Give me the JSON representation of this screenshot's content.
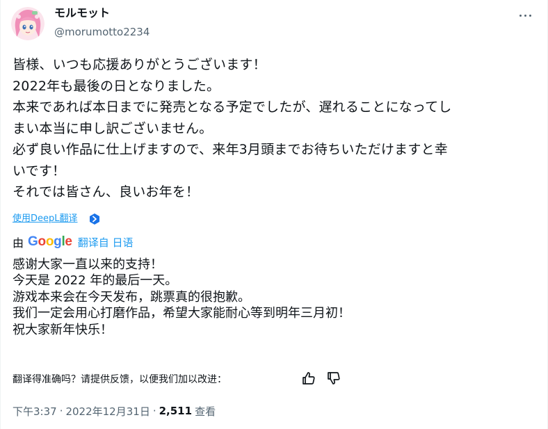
{
  "author": {
    "display_name": "モルモット",
    "handle": "@morumotto2234"
  },
  "tweet": {
    "text": "皆様、いつも応援ありがとうございます！\n2022年も最後の日となりました。\n本来であれば本日までに発売となる予定でしたが、遅れることになってし\nまい本当に申し訳ございません。\n必ず良い作品に仕上げますので、来年3月頭までお待ちいただけますと幸\nいです！\nそれでは皆さん、良いお年を！",
    "deepl_link": "使用DeepL翻译",
    "translated_by_prefix": "由",
    "google_logo_letters": [
      "G",
      "o",
      "o",
      "g",
      "l",
      "e"
    ],
    "translated_from": "翻译自 日语",
    "translated_text": "感谢大家一直以来的支持！\n今天是 2022 年的最后一天。\n游戏本来会在今天发布，跳票真的很抱歉。\n我们一定会用心打磨作品，希望大家能耐心等到明年三月初！\n祝大家新年快乐！",
    "feedback_prompt": "翻译得准确吗？请提供反馈，以便我们加以改进：",
    "time": "下午3:37",
    "date": "2022年12月31日",
    "separator": "·",
    "views_count": "2,511",
    "views_label": "查看"
  },
  "colors": {
    "google_blue": "#4285f4",
    "google_red": "#ea4335",
    "google_yellow": "#fbbc05",
    "google_green": "#34a853",
    "link_blue": "#1d9bf0",
    "secondary_text": "#536471"
  },
  "icons": {
    "more": "more-horizontal-icon",
    "deepl": "deepl-icon",
    "thumb_up": "thumbs-up-icon",
    "thumb_down": "thumbs-down-icon"
  }
}
